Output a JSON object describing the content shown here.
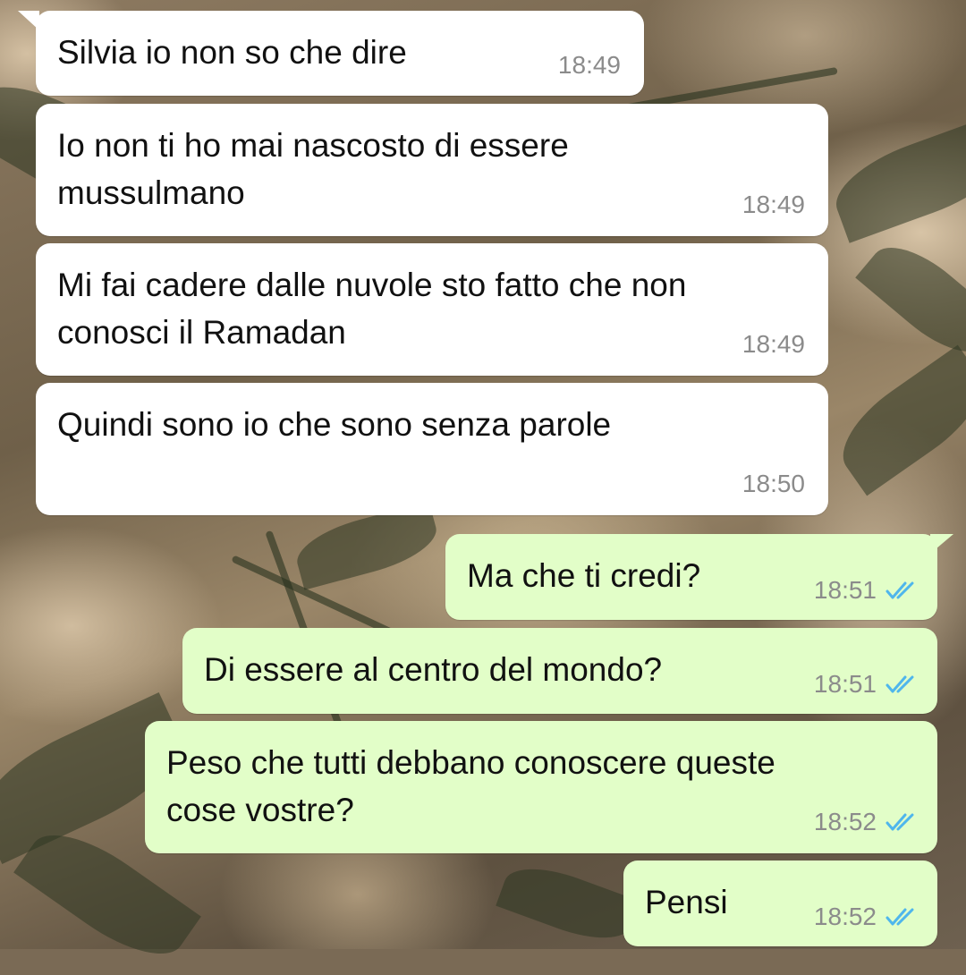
{
  "colors": {
    "incoming_bubble": "#ffffff",
    "outgoing_bubble": "#e2fec8",
    "timestamp": "#8b8b8b",
    "read_check": "#4fb6ec"
  },
  "messages": [
    {
      "direction": "incoming",
      "text": "Silvia io non so che dire",
      "time": "18:49"
    },
    {
      "direction": "incoming",
      "text": "Io non ti ho mai nascosto di essere\nmussulmano",
      "time": "18:49"
    },
    {
      "direction": "incoming",
      "text": "Mi fai cadere dalle nuvole sto fatto che non\nconosci il Ramadan",
      "time": "18:49"
    },
    {
      "direction": "incoming",
      "text": "Quindi sono io che sono senza parole",
      "time": "18:50"
    },
    {
      "direction": "outgoing",
      "text": "Ma che ti credi?",
      "time": "18:51",
      "status_icon": "double-check-read-icon"
    },
    {
      "direction": "outgoing",
      "text": "Di essere al centro del mondo?",
      "time": "18:51",
      "status_icon": "double-check-read-icon"
    },
    {
      "direction": "outgoing",
      "text": "Peso che tutti debbano conoscere queste\ncose vostre?",
      "time": "18:52",
      "status_icon": "double-check-read-icon"
    },
    {
      "direction": "outgoing",
      "text": "Pensi",
      "time": "18:52",
      "status_icon": "double-check-read-icon"
    }
  ]
}
